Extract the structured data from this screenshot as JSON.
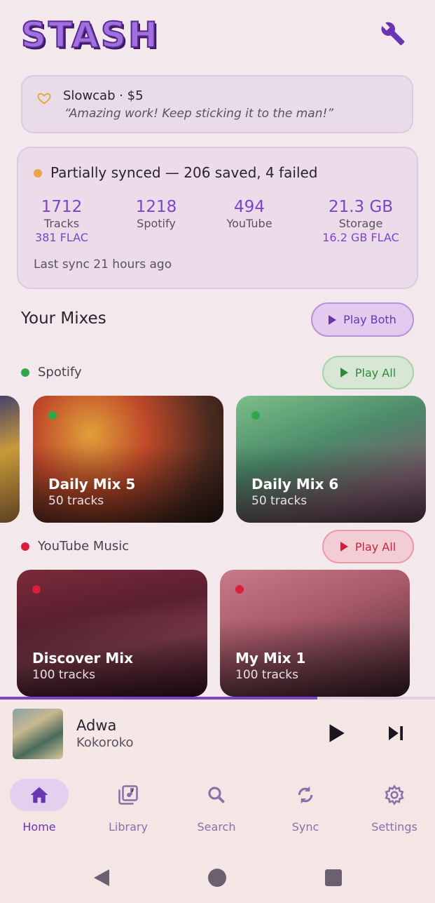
{
  "app": {
    "logo_text": "STASH"
  },
  "header": {
    "settings_icon": "wrench-icon"
  },
  "donation": {
    "name": "Slowcab · $5",
    "message": "“Amazing work! Keep sticking it to the man!”",
    "icon": "heart-icon"
  },
  "sync": {
    "status": "Partially synced — 206 saved, 4 failed",
    "status_color": "#eba447",
    "stats": [
      {
        "value": "1712",
        "label": "Tracks",
        "sub": "381 FLAC"
      },
      {
        "value": "1218",
        "label": "Spotify",
        "sub": ""
      },
      {
        "value": "494",
        "label": "YouTube",
        "sub": ""
      },
      {
        "value": "21.3 GB",
        "label": "Storage",
        "sub": "16.2 GB FLAC"
      }
    ],
    "last_sync": "Last sync 21 hours ago"
  },
  "mixes": {
    "title": "Your Mixes",
    "play_both": "Play Both",
    "spotify": {
      "label": "Spotify",
      "color": "#2fa84a",
      "play_all": "Play All",
      "cards": [
        {
          "title": "Daily Mix 5",
          "sub": "50 tracks"
        },
        {
          "title": "Daily Mix 6",
          "sub": "50 tracks"
        }
      ]
    },
    "youtube": {
      "label": "YouTube Music",
      "color": "#d81f3c",
      "play_all": "Play All",
      "cards": [
        {
          "title": "Discover Mix",
          "sub": "100 tracks"
        },
        {
          "title": "My Mix 1",
          "sub": "100 tracks"
        }
      ]
    }
  },
  "now_playing": {
    "title": "Adwa",
    "artist": "Kokoroko",
    "progress": 0.73
  },
  "nav": {
    "items": [
      {
        "label": "Home",
        "icon": "home-icon",
        "active": true
      },
      {
        "label": "Library",
        "icon": "library-icon"
      },
      {
        "label": "Search",
        "icon": "search-icon"
      },
      {
        "label": "Sync",
        "icon": "sync-icon"
      },
      {
        "label": "Settings",
        "icon": "gear-icon"
      }
    ]
  },
  "colors": {
    "accent": "#7a45c8",
    "background": "#f3e9ec"
  }
}
